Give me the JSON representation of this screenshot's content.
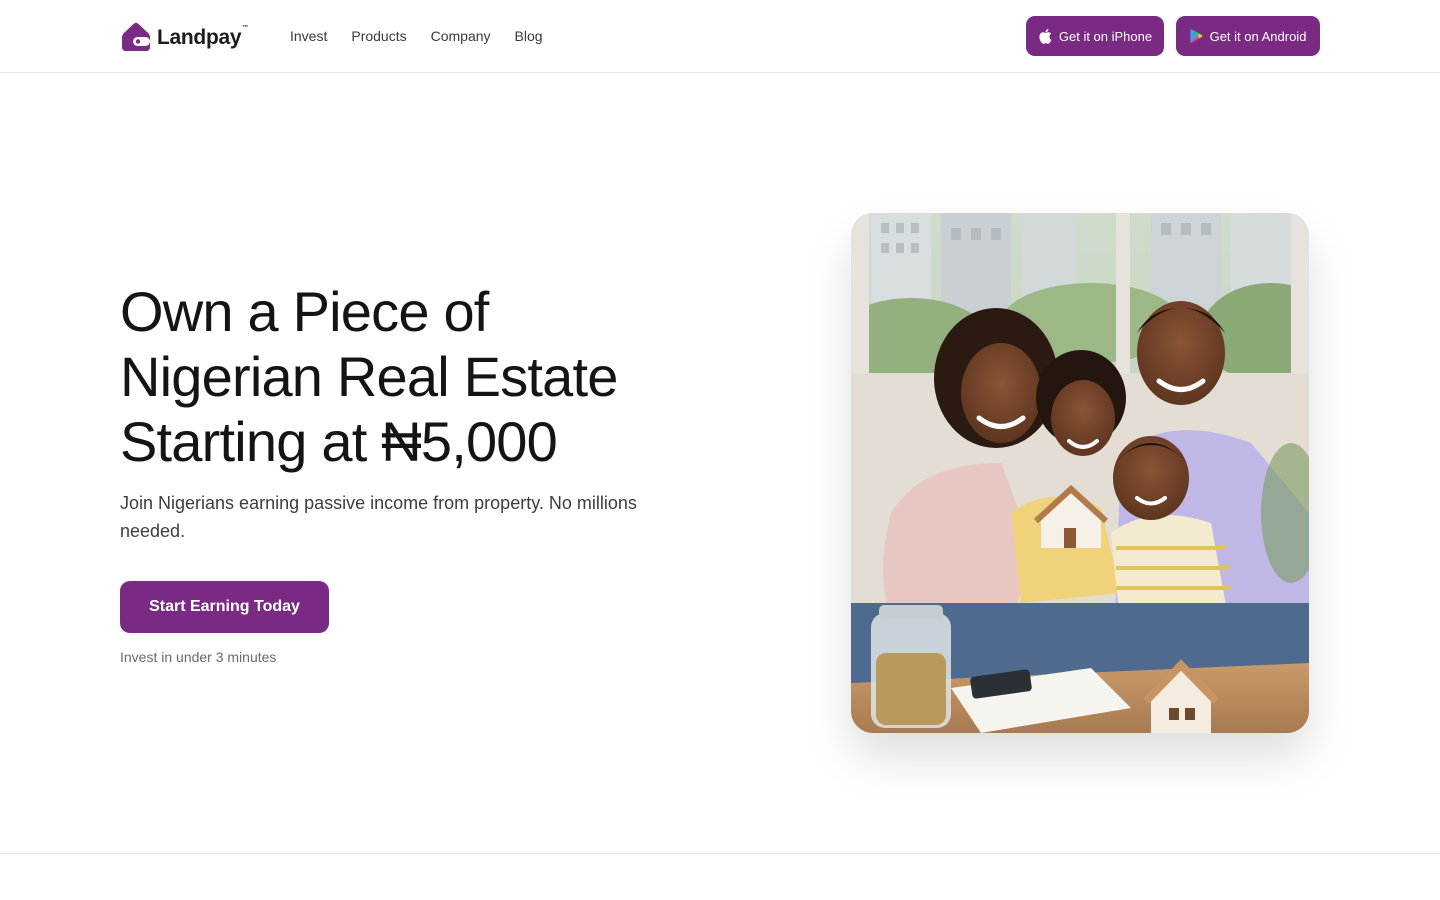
{
  "brand": {
    "name": "Landpay",
    "trademark": "™",
    "color": "#7a2a82"
  },
  "nav": {
    "items": [
      "Invest",
      "Products",
      "Company",
      "Blog"
    ]
  },
  "header": {
    "iphone_label": "Get it on iPhone",
    "android_label": "Get it on Android",
    "iphone_icon": "apple-icon",
    "android_icon": "google-play-icon"
  },
  "hero": {
    "headline_line1": "Own a Piece of",
    "headline_line2": "Nigerian Real Estate",
    "headline_line3": "Starting at ₦5,000",
    "subheadline": "Join Nigerians earning passive income from property. No millions needed.",
    "cta_label": "Start Earning Today",
    "note": "Invest in under 3 minutes",
    "image": "family-with-house-model-photo"
  }
}
